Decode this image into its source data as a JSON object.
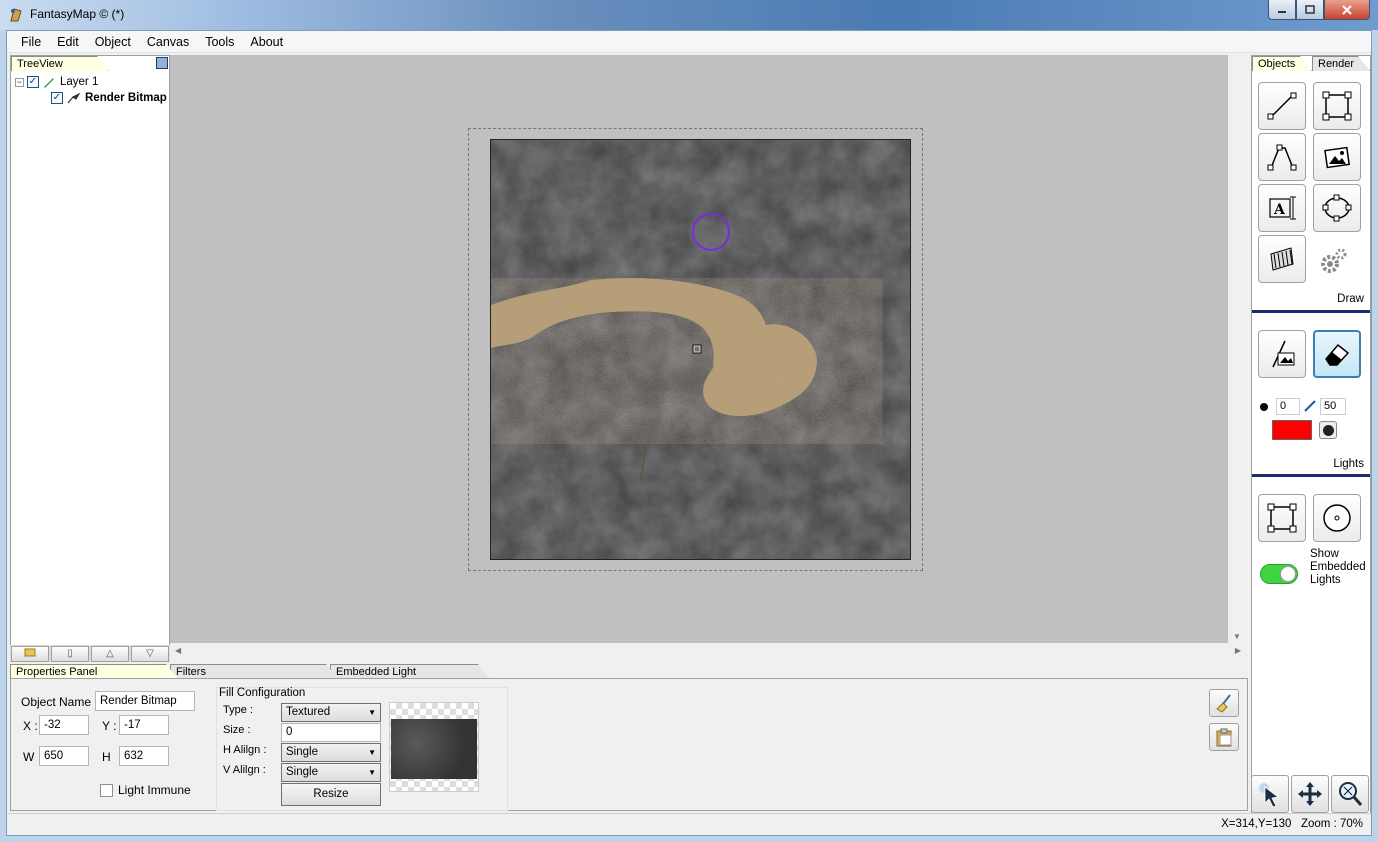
{
  "window": {
    "title": "FantasyMap © (*)"
  },
  "menu": [
    "File",
    "Edit",
    "Object",
    "Canvas",
    "Tools",
    "About"
  ],
  "tree": {
    "tab": "TreeView",
    "items": [
      {
        "label": "Layer 1",
        "checked": true
      },
      {
        "label": "Render Bitmap",
        "checked": true
      }
    ]
  },
  "right_panel": {
    "tabs": [
      "Objects",
      "Render"
    ],
    "draw_label": "Draw",
    "lights_label": "Lights",
    "brush_size": "0",
    "brush_opacity": "50",
    "brush_color": "#ff0000",
    "show_embedded_lights": "Show\nEmbedded\nLights"
  },
  "bottom_tabs": [
    "Properties Panel",
    "Filters",
    "Embedded Light"
  ],
  "properties": {
    "object_name_label": "Object Name",
    "object_name": "Render Bitmap",
    "x_label": "X :",
    "x": "-32",
    "y_label": "Y :",
    "y": "-17",
    "w_label": "W",
    "w": "650",
    "h_label": "H",
    "h": "632",
    "light_immune": "Light Immune"
  },
  "fill": {
    "title": "Fill Configuration",
    "type_label": "Type :",
    "type": "Textured",
    "size_label": "Size :",
    "size": "0",
    "halign_label": "H Alilgn :",
    "halign": "Single",
    "valign_label": "V Alilgn :",
    "valign": "Single",
    "resize_label": "Resize"
  },
  "status": {
    "text": "X=314,Y=130   Zoom : 70%"
  }
}
